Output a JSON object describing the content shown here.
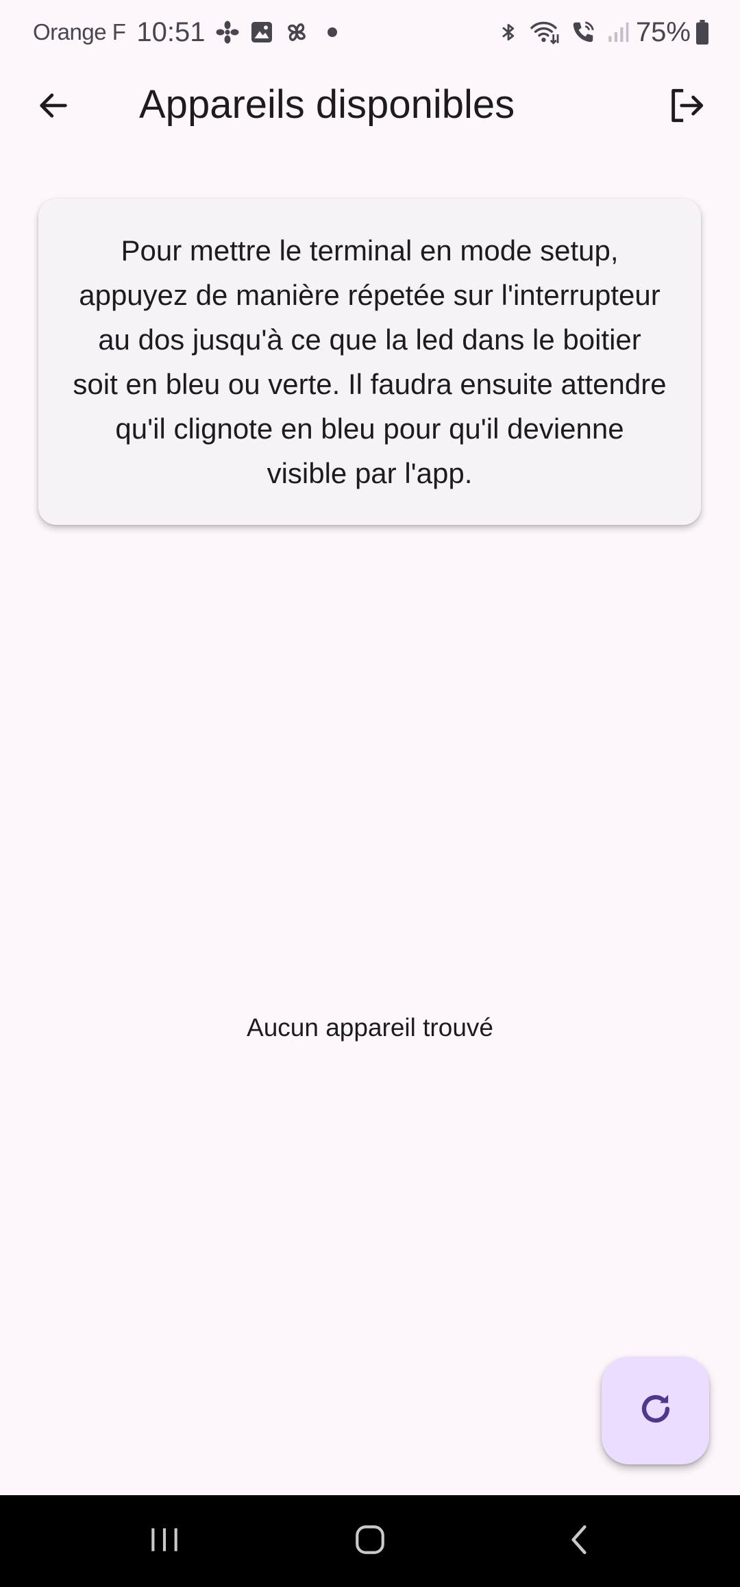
{
  "status_bar": {
    "carrier": "Orange F",
    "time": "10:51",
    "battery": "75%",
    "left_icons": [
      "fan-icon",
      "gallery-icon",
      "pinwheel-icon",
      "dot-icon"
    ],
    "right_icons": [
      "bluetooth-icon",
      "wifi-icon",
      "call-icon",
      "signal-icon",
      "battery-icon"
    ]
  },
  "app_bar": {
    "title": "Appareils disponibles",
    "back_icon": "arrow-back-icon",
    "logout_icon": "logout-icon"
  },
  "info_card": {
    "text": "Pour mettre le terminal en mode setup, appuyez de manière répetée sur l'interrupteur au dos jusqu'à ce que la led dans le boitier soit en bleu ou verte. Il faudra ensuite attendre qu'il clignote en bleu pour qu'il devienne visible par l'app."
  },
  "device_list": {
    "empty_message": "Aucun appareil trouvé"
  },
  "fab": {
    "icon": "refresh-icon"
  },
  "colors": {
    "background": "#fdf7fc",
    "card": "#f7f2f7",
    "fab": "#eaddff",
    "fab_icon": "#4f378b",
    "text": "#1d1b20"
  },
  "nav_bar": {
    "buttons": [
      "recents-icon",
      "home-icon",
      "nav-back-icon"
    ]
  }
}
